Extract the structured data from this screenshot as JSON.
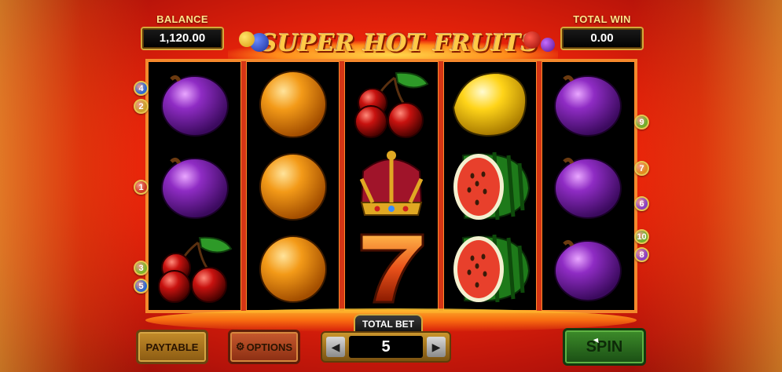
{
  "header": {
    "balance_label": "BALANCE",
    "balance_value": "1,120.00",
    "total_win_label": "TOTAL WIN",
    "total_win_value": "0.00",
    "logo_text": "SUPER HOT FRUITS"
  },
  "reels": [
    [
      "plum",
      "plum",
      "cherry"
    ],
    [
      "orange",
      "orange",
      "orange"
    ],
    [
      "cherry",
      "crown",
      "seven"
    ],
    [
      "lemon",
      "watermelon",
      "watermelon"
    ],
    [
      "plum",
      "plum",
      "plum"
    ]
  ],
  "paylines": {
    "left": [
      {
        "num": "4",
        "color": "#2e6ad0"
      },
      {
        "num": "2",
        "color": "#c9a12a"
      },
      {
        "num": "1",
        "color": "#d03a24"
      },
      {
        "num": "3",
        "color": "#7fb52a"
      },
      {
        "num": "5",
        "color": "#2e6ad0"
      }
    ],
    "right": [
      {
        "num": "9",
        "color": "#6fae2a"
      },
      {
        "num": "7",
        "color": "#e28a1e"
      },
      {
        "num": "6",
        "color": "#8a3fc4"
      },
      {
        "num": "10",
        "color": "#6fae2a"
      },
      {
        "num": "8",
        "color": "#8a3fc4"
      }
    ]
  },
  "controls": {
    "paytable_label": "PAYTABLE",
    "options_label": "OPTIONS",
    "total_bet_label": "TOTAL BET",
    "total_bet_value": "5",
    "spin_label": "SPIN"
  },
  "colors": {
    "plum": "#8f2cc4",
    "orange": "#f39a18",
    "cherry": "#c8120f",
    "lemon": "#ffd419",
    "watermelon_rind": "#1e7a1a",
    "watermelon_flesh": "#e8402c",
    "crown": "#e0a823",
    "seven": "#e9511a"
  }
}
